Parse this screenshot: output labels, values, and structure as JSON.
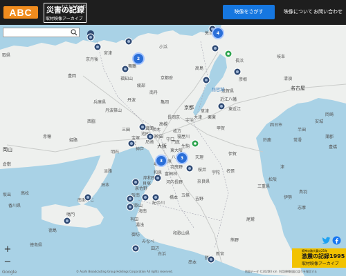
{
  "header": {
    "abc_logo": "ABC",
    "archive_logo": {
      "main": "災害の記録",
      "small": "わたしたちは忘れない",
      "sub": "取材映像アーカイブ"
    },
    "search_video_button": "映像をさがす",
    "nav": [
      "映像について",
      "お問い合わせ"
    ]
  },
  "search": {
    "placeholder": "",
    "value": ""
  },
  "map": {
    "place_labels": [
      {
        "id": "kyoto-pref",
        "text": "京都府"
      },
      {
        "id": "hyogo-pref",
        "text": "兵庫県"
      },
      {
        "id": "shiga-pref",
        "text": "滋賀県"
      },
      {
        "id": "mie-pref",
        "text": "三重県"
      },
      {
        "id": "nara-pref",
        "text": "奈良県"
      },
      {
        "id": "wakayama-pref",
        "text": "和歌山県"
      },
      {
        "id": "kagawa-pref",
        "text": "香川県"
      },
      {
        "id": "tokushima-pref",
        "text": "徳島県"
      },
      {
        "id": "nagoya",
        "text": "名古屋"
      },
      {
        "id": "kyoto",
        "text": "京都"
      },
      {
        "id": "osaka",
        "text": "大阪"
      },
      {
        "id": "okayama",
        "text": "岡山"
      },
      {
        "id": "gifu",
        "text": "岐阜"
      },
      {
        "id": "tsu",
        "text": "津"
      },
      {
        "id": "maizuru",
        "text": "舞鶴"
      },
      {
        "id": "fukuchiyama",
        "text": "福知山"
      },
      {
        "id": "tamba",
        "text": "丹波"
      },
      {
        "id": "kameoka",
        "text": "亀岡"
      },
      {
        "id": "kobe",
        "text": "神戸"
      },
      {
        "id": "tottori",
        "text": "取県"
      },
      {
        "id": "tomioka",
        "text": "豊岡"
      },
      {
        "id": "tanba-sasayama",
        "text": "丹波篠山"
      },
      {
        "id": "kyotango",
        "text": "京丹後"
      },
      {
        "id": "miyazu",
        "text": "宮津"
      },
      {
        "id": "ayabe",
        "text": "綾部"
      },
      {
        "id": "nantan",
        "text": "南丹"
      },
      {
        "id": "takashima",
        "text": "高島"
      },
      {
        "id": "nagahama",
        "text": "長浜"
      },
      {
        "id": "hikone",
        "text": "彦根"
      },
      {
        "id": "omihachiman",
        "text": "近江八幡"
      },
      {
        "id": "koka",
        "text": "甲賀"
      },
      {
        "id": "iga",
        "text": "伊賀"
      },
      {
        "id": "nabari",
        "text": "名張"
      },
      {
        "id": "yokkaichi",
        "text": "四日市"
      },
      {
        "id": "suzuka",
        "text": "鈴鹿"
      },
      {
        "id": "matsusaka",
        "text": "松阪"
      },
      {
        "id": "ise",
        "text": "伊勢"
      },
      {
        "id": "toba",
        "text": "鳥羽"
      },
      {
        "id": "shima",
        "text": "志摩"
      },
      {
        "id": "kiyosu",
        "text": "清須"
      },
      {
        "id": "anjo",
        "text": "安城"
      },
      {
        "id": "okazaki",
        "text": "岡崎"
      },
      {
        "id": "toyohashi",
        "text": "豊橋"
      },
      {
        "id": "gamagori",
        "text": "蒲郡"
      },
      {
        "id": "handa",
        "text": "半田"
      },
      {
        "id": "tokoname",
        "text": "常滑"
      },
      {
        "id": "himeji",
        "text": "姫路"
      },
      {
        "id": "akashi",
        "text": "明石"
      },
      {
        "id": "awaji",
        "text": "淡路"
      },
      {
        "id": "sumoto",
        "text": "洲本"
      },
      {
        "id": "minamiawaji",
        "text": "南あわじ"
      },
      {
        "id": "naruto",
        "text": "鳴門"
      },
      {
        "id": "tokushima",
        "text": "徳島"
      },
      {
        "id": "takamatsu",
        "text": "高松"
      },
      {
        "id": "sakaide",
        "text": "坂出"
      },
      {
        "id": "kishiwada",
        "text": "岸和田"
      },
      {
        "id": "izumisano",
        "text": "泉佐野"
      },
      {
        "id": "hashimoto",
        "text": "橋本"
      },
      {
        "id": "kinokawa",
        "text": "紀の川"
      },
      {
        "id": "wakayama",
        "text": "和歌山"
      },
      {
        "id": "arida",
        "text": "有田"
      },
      {
        "id": "gobo",
        "text": "御坊"
      },
      {
        "id": "tanabe",
        "text": "田辺"
      },
      {
        "id": "gojo",
        "text": "五條"
      },
      {
        "id": "yoshino",
        "text": "吉野"
      },
      {
        "id": "shingu",
        "text": "新宮"
      },
      {
        "id": "owase",
        "text": "尾鷲"
      },
      {
        "id": "kumano",
        "text": "熊野"
      },
      {
        "id": "biwako",
        "text": "琵琶湖"
      },
      {
        "id": "sakai",
        "text": "堺"
      },
      {
        "id": "tsuruga",
        "text": "敦賀"
      },
      {
        "id": "obama",
        "text": "小浜"
      },
      {
        "id": "kurashiki",
        "text": "倉敷"
      },
      {
        "id": "ako",
        "text": "赤穂"
      },
      {
        "id": "nishiwaki",
        "text": "西脇"
      },
      {
        "id": "sanda",
        "text": "三田"
      },
      {
        "id": "ikoma",
        "text": "生駒"
      },
      {
        "id": "tenri",
        "text": "天理"
      },
      {
        "id": "sakurai",
        "text": "桜井"
      },
      {
        "id": "uda",
        "text": "宇陀"
      },
      {
        "id": "higashiomi",
        "text": "東近江"
      },
      {
        "id": "ritto",
        "text": "栗東"
      },
      {
        "id": "kusatsu",
        "text": "草津"
      },
      {
        "id": "otsu",
        "text": "大津"
      },
      {
        "id": "uji",
        "text": "宇治"
      },
      {
        "id": "nagaokakyo",
        "text": "長岡京"
      },
      {
        "id": "hirakata",
        "text": "枚方"
      },
      {
        "id": "takatsuki",
        "text": "高槻"
      },
      {
        "id": "ibaraki",
        "text": "茨木"
      },
      {
        "id": "minoh",
        "text": "箕面"
      },
      {
        "id": "ikeda",
        "text": "池田"
      },
      {
        "id": "takarazuka",
        "text": "宝塚"
      },
      {
        "id": "nishinomiya",
        "text": "西宮"
      },
      {
        "id": "amagasaki",
        "text": "尼崎"
      },
      {
        "id": "toyonaka",
        "text": "豊中"
      },
      {
        "id": "suita",
        "text": "吹田"
      },
      {
        "id": "moriguchi",
        "text": "守口"
      },
      {
        "id": "kadoma",
        "text": "門真"
      },
      {
        "id": "neyagawa",
        "text": "寝屋川"
      },
      {
        "id": "higashiosaka",
        "text": "東大阪"
      },
      {
        "id": "yao",
        "text": "八尾"
      },
      {
        "id": "matsubara",
        "text": "松原"
      },
      {
        "id": "habikino",
        "text": "羽曳野"
      },
      {
        "id": "tondabayashi",
        "text": "富田林"
      },
      {
        "id": "kawachinagano",
        "text": "河内長野"
      },
      {
        "id": "izumi",
        "text": "和泉"
      },
      {
        "id": "kaizuka",
        "text": "貝塚"
      },
      {
        "id": "hannan",
        "text": "阪南"
      },
      {
        "id": "kainan",
        "text": "海南"
      },
      {
        "id": "yuasa",
        "text": "湯浅"
      },
      {
        "id": "minabe",
        "text": "みなべ"
      },
      {
        "id": "shirahama",
        "text": "白浜"
      },
      {
        "id": "kushimoto",
        "text": "串本"
      },
      {
        "id": "katsuura",
        "text": "勝浦"
      }
    ],
    "clusters": [
      {
        "id": "cluster-2",
        "count": "2"
      },
      {
        "id": "cluster-4",
        "count": "4"
      },
      {
        "id": "cluster-3a",
        "count": "3"
      },
      {
        "id": "cluster-3b",
        "count": "3"
      }
    ]
  },
  "zoom": {
    "in": "+",
    "out": "−"
  },
  "banner": {
    "line1": "阪神淡路大震災25年",
    "line2": "激震の記録1995",
    "line3": "取材映像アーカイブ",
    "chevron": "›"
  },
  "attribution": {
    "google": "Google",
    "copyright": "© Asahi Broadcasting Group Holdings Corporation All rights reserved.",
    "map_data": "地図データ ©2020",
    "scale": "20 km",
    "terms": "利用規約",
    "report": "地図の誤りを報告する"
  },
  "colors": {
    "header_bg": "#1e1e1e",
    "abc_orange": "#f08c1e",
    "button_blue": "#1677e0",
    "sea": "#a9d2e6",
    "land": "#eef0ee",
    "pin": "#2f4a73",
    "cluster": "#2b6fd8",
    "green_pin": "#2ea44f",
    "banner": "#f2c200"
  }
}
